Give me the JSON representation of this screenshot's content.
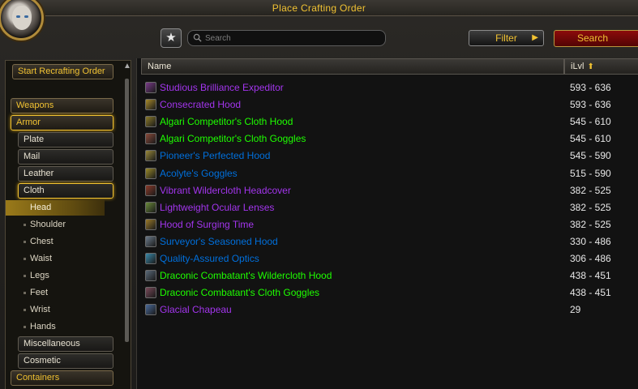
{
  "window": {
    "title": "Place Crafting Order"
  },
  "toolbar": {
    "favorites_icon": "star-icon",
    "search_placeholder": "Search",
    "filter_label": "Filter",
    "search_label": "Search"
  },
  "sidebar": {
    "recraft_label": "Start Recrafting Order",
    "categories": [
      {
        "label": "Weapons"
      },
      {
        "label": "Armor",
        "active": true
      }
    ],
    "armor_sub": [
      {
        "label": "Plate"
      },
      {
        "label": "Mail"
      },
      {
        "label": "Leather"
      },
      {
        "label": "Cloth",
        "active": true
      }
    ],
    "cloth_slots": [
      {
        "label": "Head",
        "selected": true
      },
      {
        "label": "Shoulder"
      },
      {
        "label": "Chest"
      },
      {
        "label": "Waist"
      },
      {
        "label": "Legs"
      },
      {
        "label": "Feet"
      },
      {
        "label": "Wrist"
      },
      {
        "label": "Hands"
      }
    ],
    "armor_more": [
      {
        "label": "Miscellaneous"
      },
      {
        "label": "Cosmetic"
      }
    ],
    "more_categories": [
      {
        "label": "Containers"
      }
    ]
  },
  "table": {
    "headers": {
      "name": "Name",
      "ilvl": "iLvl"
    },
    "rows": [
      {
        "name": "Studious Brilliance Expeditor",
        "ilvl": "593 - 636",
        "color": "#a335ee",
        "icon_color": "#7a3a8a"
      },
      {
        "name": "Consecrated Hood",
        "ilvl": "593 - 636",
        "color": "#a335ee",
        "icon_color": "#a88a2a"
      },
      {
        "name": "Algari Competitor's Cloth Hood",
        "ilvl": "545 - 610",
        "color": "#1eff00",
        "icon_color": "#8a7a2a"
      },
      {
        "name": "Algari Competitor's Cloth Goggles",
        "ilvl": "545 - 610",
        "color": "#1eff00",
        "icon_color": "#8a4a3a"
      },
      {
        "name": "Pioneer's Perfected Hood",
        "ilvl": "545 - 590",
        "color": "#0070dd",
        "icon_color": "#9a8a3a"
      },
      {
        "name": "Acolyte's Goggles",
        "ilvl": "515 - 590",
        "color": "#0070dd",
        "icon_color": "#9a8a2a"
      },
      {
        "name": "Vibrant Wildercloth Headcover",
        "ilvl": "382 - 525",
        "color": "#a335ee",
        "icon_color": "#8a3a2a"
      },
      {
        "name": "Lightweight Ocular Lenses",
        "ilvl": "382 - 525",
        "color": "#a335ee",
        "icon_color": "#6a8a3a"
      },
      {
        "name": "Hood of Surging Time",
        "ilvl": "382 - 525",
        "color": "#a335ee",
        "icon_color": "#9a7a2a"
      },
      {
        "name": "Surveyor's Seasoned Hood",
        "ilvl": "330 - 486",
        "color": "#0070dd",
        "icon_color": "#6a7a8a"
      },
      {
        "name": "Quality-Assured Optics",
        "ilvl": "306 - 486",
        "color": "#0070dd",
        "icon_color": "#3a8aaa"
      },
      {
        "name": "Draconic Combatant's Wildercloth Hood",
        "ilvl": "438 - 451",
        "color": "#1eff00",
        "icon_color": "#5a6a7a"
      },
      {
        "name": "Draconic Combatant's Cloth Goggles",
        "ilvl": "438 - 451",
        "color": "#1eff00",
        "icon_color": "#7a4a5a"
      },
      {
        "name": "Glacial Chapeau",
        "ilvl": "29",
        "color": "#a335ee",
        "icon_color": "#4a6a9a"
      }
    ]
  }
}
